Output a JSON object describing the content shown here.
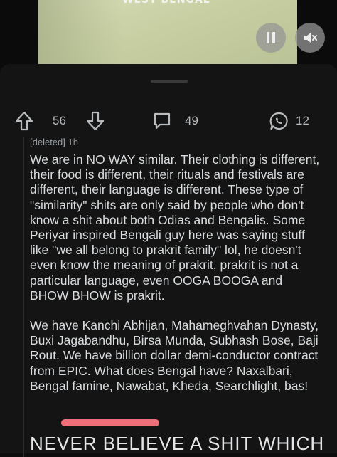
{
  "video": {
    "caption": "WEST BENGAL"
  },
  "actions": {
    "upvotes": "56",
    "comments": "49",
    "shares": "12"
  },
  "comment": {
    "author": "[deleted]",
    "age": "1h",
    "paragraphs": [
      "We are in NO WAY similar. Their clothing is different, their food is different, their rituals and festivals are different, their language is different. These type of \"similarity\" shits are only said by people who don't know a shit about both Odias and Bengalis. Some Periyar inspired Bengali guy here was saying stuff like \"we all belong to prakrit family\" lol, he doesn't even know the meaning of prakrit, prakrit is not a particular language, even OOGA BOOGA and BHOW BHOW is prakrit.",
      "We have Kanchi Abhijan, Mahameghvahan Dynasty, Buxi Jagabandhu, Birsa Munda, Subhash Bose, Baji Rout. We have billion dollar demi-conductor contract from EPIC. What does Bengal have? Naxalbari, Bengal famine, Nawabat, Kheda, Searchlight, bas!"
    ]
  },
  "next_heading": "NEVER BELIEVE A SHIT WHICH",
  "colors": {
    "background": "#0d0d0d",
    "sheet": "#141414",
    "highlight": "#ef6f78"
  }
}
